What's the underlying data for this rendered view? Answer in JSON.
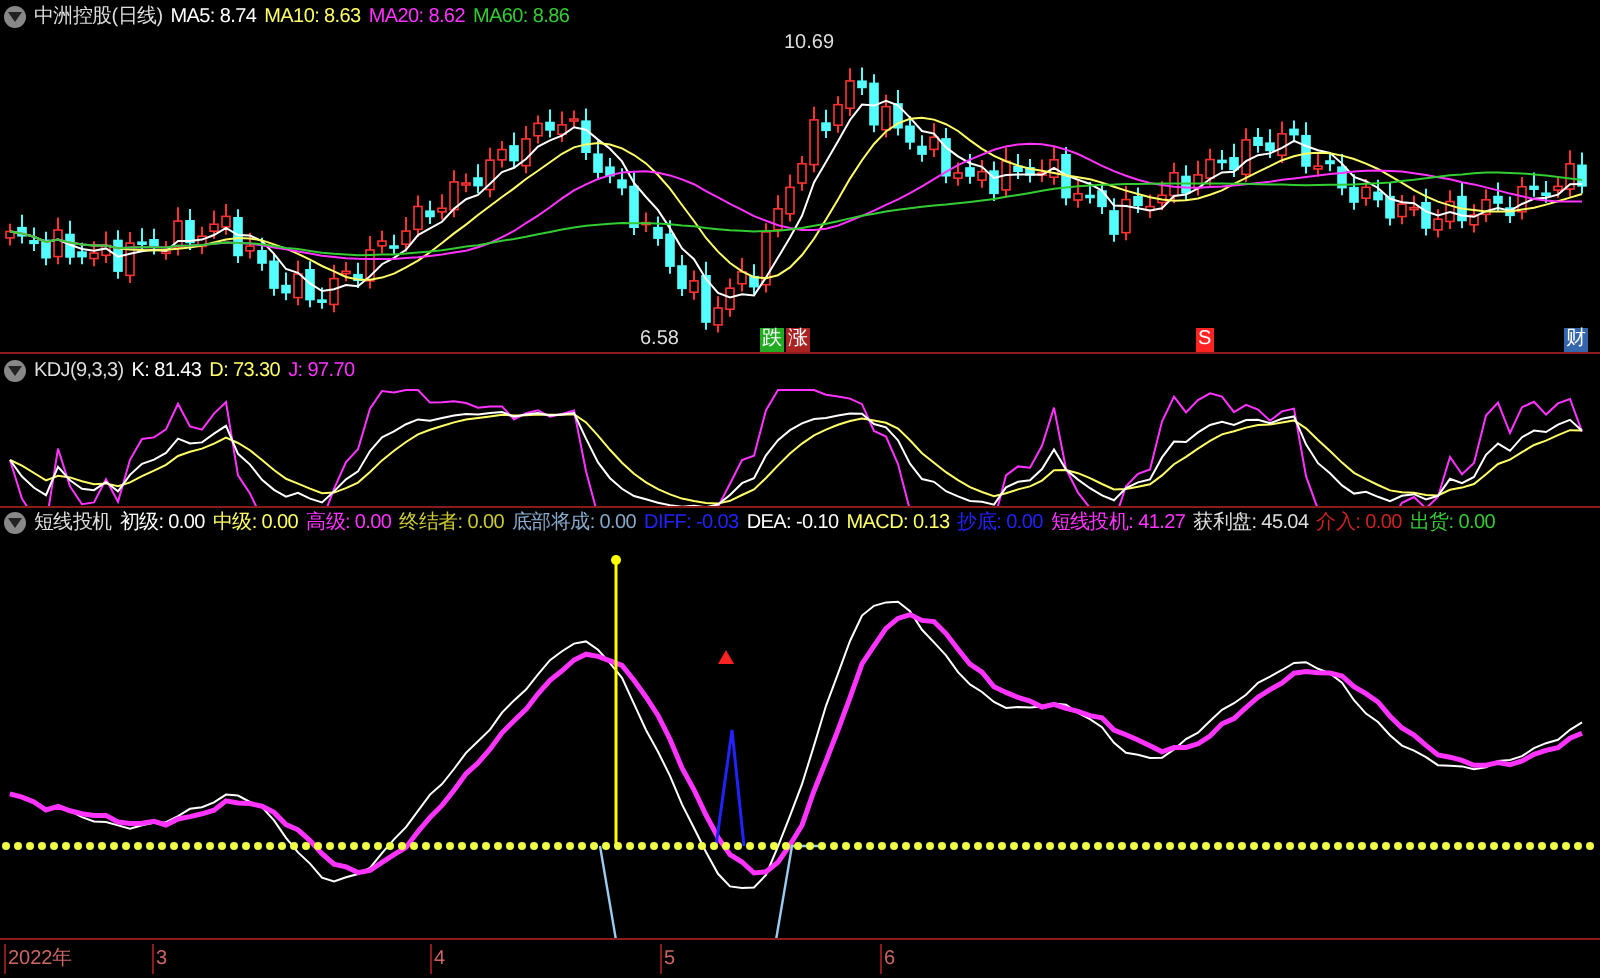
{
  "price_panel": {
    "title": "中洲控股(日线)",
    "indicators": [
      {
        "label": "MA5: 8.74",
        "color": "#ffffff"
      },
      {
        "label": "MA10: 8.63",
        "color": "#ffff66"
      },
      {
        "label": "MA20: 8.62",
        "color": "#ff33ff"
      },
      {
        "label": "MA60: 8.86",
        "color": "#33cc33"
      }
    ],
    "high_label": "10.69",
    "low_label": "6.58",
    "markers": [
      {
        "text": "跌",
        "color": "#22aa22"
      },
      {
        "text": "涨",
        "color": "#aa2222"
      },
      {
        "text": "S",
        "color": "#ff2222"
      },
      {
        "text": "财",
        "color": "#3366aa"
      }
    ]
  },
  "kdj_panel": {
    "title": "KDJ(9,3,3)",
    "indicators": [
      {
        "label": "K: 81.43",
        "color": "#ffffff"
      },
      {
        "label": "D: 73.30",
        "color": "#ffff66"
      },
      {
        "label": "J: 97.70",
        "color": "#ff33ff"
      }
    ]
  },
  "signal_panel": {
    "title": "短线投机",
    "indicators": [
      {
        "label": "初级: 0.00",
        "color": "#ffffff"
      },
      {
        "label": "中级: 0.00",
        "color": "#ffff66"
      },
      {
        "label": "高级: 0.00",
        "color": "#ff33ff"
      },
      {
        "label": "终结者: 0.00",
        "color": "#cccc33"
      },
      {
        "label": "底部将成: 0.00",
        "color": "#88aacc"
      },
      {
        "label": "DIFF: -0.03",
        "color": "#2222ff"
      },
      {
        "label": "DEA: -0.10",
        "color": "#ffffff"
      },
      {
        "label": "MACD: 0.13",
        "color": "#ffff66"
      },
      {
        "label": "抄底: 0.00",
        "color": "#2222ff"
      },
      {
        "label": "短线投机: 41.27",
        "color": "#ff33ff"
      },
      {
        "label": "获利盘: 45.04",
        "color": "#dddddd"
      },
      {
        "label": "介入: 0.00",
        "color": "#cc2222"
      },
      {
        "label": "出货: 0.00",
        "color": "#33cc33"
      }
    ]
  },
  "time_axis": [
    "2022年",
    "3",
    "4",
    "5",
    "6"
  ]
}
